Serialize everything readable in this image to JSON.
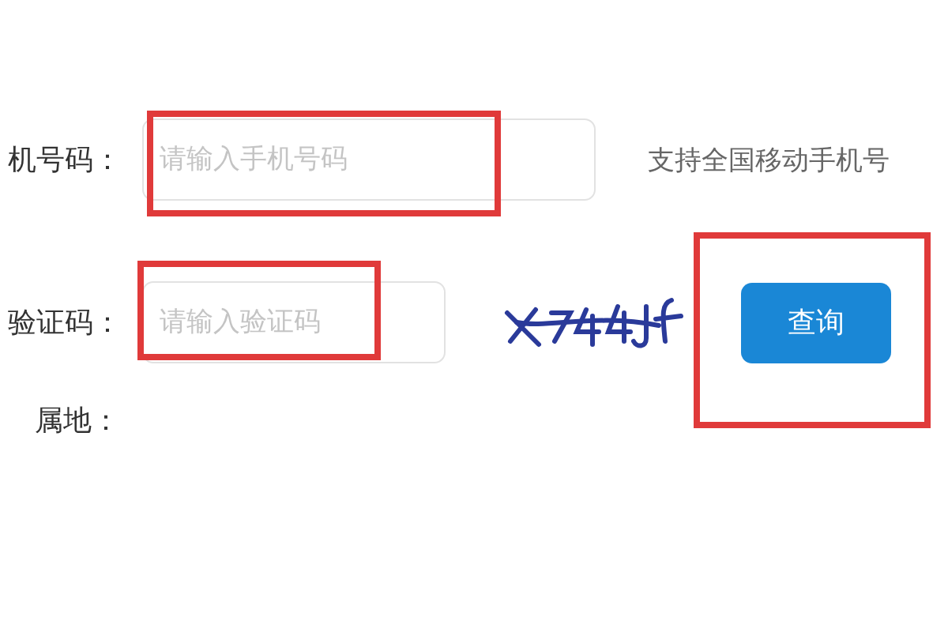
{
  "phone": {
    "label": "机号码：",
    "placeholder": "请输入手机号码",
    "hint": "支持全国移动手机号",
    "highlighted": true
  },
  "captcha": {
    "label": "验证码：",
    "placeholder": "请输入验证码",
    "highlighted": true
  },
  "query_button": {
    "label": "查询",
    "highlighted": true
  },
  "location": {
    "label": "属地："
  }
}
